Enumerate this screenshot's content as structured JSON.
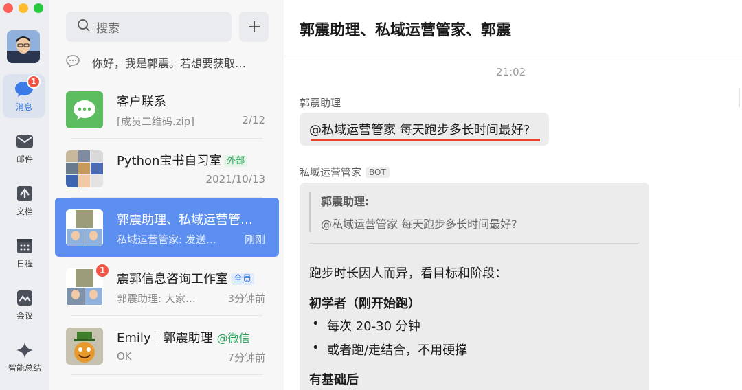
{
  "rail": {
    "items": [
      {
        "label": "消息",
        "icon": "chat-bubble-icon",
        "badge": "1",
        "active": true
      },
      {
        "label": "邮件",
        "icon": "mail-icon"
      },
      {
        "label": "文档",
        "icon": "document-icon"
      },
      {
        "label": "日程",
        "icon": "calendar-icon"
      },
      {
        "label": "会议",
        "icon": "meeting-icon"
      },
      {
        "label": "智能总结",
        "icon": "sparkle-icon"
      }
    ]
  },
  "search": {
    "placeholder": "搜索"
  },
  "system_notice": "你好，我是郭震。若想要获取…",
  "conversations": [
    {
      "name": "客户联系",
      "preview": "[成员二维码.zip]",
      "meta": "2/12"
    },
    {
      "name": "Python宝书自习室",
      "tag": "外部",
      "preview": "",
      "meta": "2021/10/13"
    },
    {
      "name": "郭震助理、私域运营管…",
      "preview": "私域运营管家: 发送…",
      "meta": "刚刚",
      "active": true
    },
    {
      "name": "震郭信息咨询工作室",
      "tag": "全员",
      "preview": "郭震助理: 大家…",
      "meta": "3分钟前",
      "badge": "1"
    },
    {
      "name": "Emily｜郭震助理",
      "tag": "@微信",
      "preview": "OK",
      "meta": "7分钟前"
    }
  ],
  "chat": {
    "title": "郭震助理、私域运营管家、郭震",
    "timestamp": "21:02",
    "msg1_sender": "郭震助理",
    "msg1_text": "@私域运营管家 每天跑步多长时间最好?",
    "msg2_sender": "私域运营管家",
    "msg2_badge": "BOT",
    "quote_name": "郭震助理:",
    "quote_text": "@私域运营管家 每天跑步多长时间最好?",
    "reply_intro": "跑步时长因人而异，看目标和阶段：",
    "section1": "初学者（刚开始跑）",
    "bullets1": [
      "每次 20-30 分钟",
      "或者跑/走结合，不用硬撑"
    ],
    "section2": "有基础后"
  },
  "colors": {
    "accent": "#5c8ff0",
    "badge": "#f25545",
    "underline": "#e8402a"
  }
}
